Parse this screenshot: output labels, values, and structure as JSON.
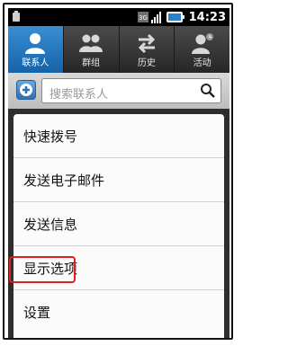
{
  "status_bar": {
    "time": "14:23"
  },
  "tabs": [
    {
      "label": "联系人",
      "icon": "person-icon",
      "active": true
    },
    {
      "label": "群组",
      "icon": "group-icon",
      "active": false
    },
    {
      "label": "历史",
      "icon": "swap-arrows-icon",
      "active": false
    },
    {
      "label": "活动",
      "icon": "person-activity-icon",
      "active": false
    }
  ],
  "search": {
    "placeholder": "搜索联系人"
  },
  "menu": {
    "items": [
      "快速拨号",
      "发送电子邮件",
      "发送信息",
      "显示选项",
      "设置"
    ],
    "highlighted_item": "显示选项"
  },
  "colors": {
    "active_tab": "#1f74bf",
    "highlight_border": "#e02020"
  }
}
